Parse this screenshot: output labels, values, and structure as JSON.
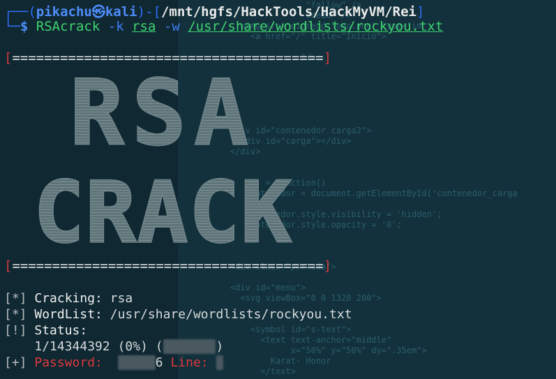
{
  "prompt": {
    "user": "pikachu",
    "host": "kali",
    "symbol": "㉿",
    "path": "/mnt/hgfs/HackTools/HackMyVM/Rei",
    "dollar": "$",
    "command": "RSAcrack",
    "flag_k": "-k",
    "arg_k": "rsa",
    "flag_w": "-w",
    "arg_w": "/usr/share/wordlists/rockyou.txt"
  },
  "separator": "[=======================================]",
  "banner": {
    "line1": "RSA",
    "line2": "CRACK"
  },
  "output": {
    "tag_star": "[*]",
    "tag_bang": "[!]",
    "tag_plus": "[+]",
    "cracking_label": "Cracking:",
    "cracking_value": "rsa",
    "wordlist_label": "WordList:",
    "wordlist_value": "/usr/share/wordlists/rockyou.txt",
    "status_label": "Status:",
    "status_value": "1/14344392 (0%) (",
    "status_close": ")",
    "password_label": "Password:",
    "password_tail": "6",
    "line_label": "Line:"
  },
  "background_code": [
    "               \"follow\" />",
    "               ccedd\" />",
    "  <img src=\"cidredd-logo.png\" type=\"im",
    "    <a href=\"/\" title=\"Inicio\">",
    "",
    "              \"/>",
    "",
    "",
    "",
    "",
    "",
    "",
    "<div id=\"contenedor carga2\">",
    "  <div id=\"carga\"></div>",
    "</div>",
    "",
    "",
    "       = function()",
    "   contenedor = document.getElementById('contenedor_carga",
    "",
    "   contenedor.style.visibility = 'hidden';",
    "   contenedor.style.opacity = '0';",
    "",
    "",
    "",
    "<div class=\"portada\">",
    "",
    "<div id=\"menu\">",
    "  <svg viewBox=\"0 0 1320 200\">",
    "",
    "",
    "    <symbol id=\"s-text\">",
    "      <text text-anchor=\"middle\"",
    "            x=\"50%\" y=\"50%\" dy=\".35em\">",
    "        Karat- Honor",
    "      </text>"
  ],
  "colors": {
    "background": "#0f2832",
    "prompt_blue": "#2f6df6",
    "command_green": "#3fd46f",
    "error_red": "#e0393e",
    "banner_fill": "#5d7378"
  }
}
